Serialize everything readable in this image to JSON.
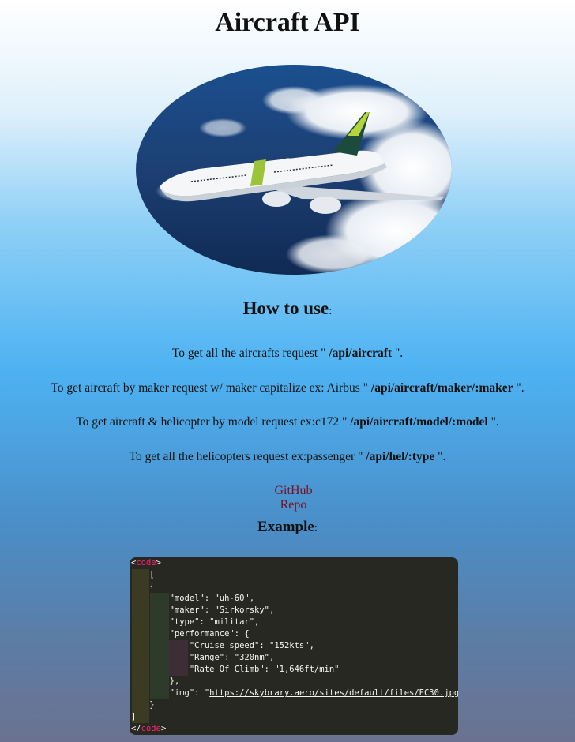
{
  "page": {
    "title": "Aircraft API"
  },
  "how_to_use": {
    "heading": "How to use",
    "colon": ":",
    "instructions": [
      {
        "prefix": "To get all the aircrafts request \" ",
        "route": "/api/aircraft",
        "suffix": " \"."
      },
      {
        "prefix": "To get aircraft by maker request w/ maker capitalize ex: Airbus \" ",
        "route": "/api/aircraft/maker/:maker",
        "suffix": " \"."
      },
      {
        "prefix": "To get aircraft & helicopter by model request ex:c172 \" ",
        "route": "/api/aircraft/model/:model",
        "suffix": " \"."
      },
      {
        "prefix": "To get all the helicopters request ex:passenger \" ",
        "route": "/api/hel/:type",
        "suffix": " \"."
      }
    ]
  },
  "github_link": {
    "label": "GitHub Repo"
  },
  "example": {
    "heading": "Example",
    "colon": ":",
    "code_open_tag": "code",
    "code_close_tag": "code",
    "lines": [
      "    [",
      "    {",
      "        \"model\": \"uh-60\",",
      "        \"maker\": \"Sirkorsky\",",
      "        \"type\": \"militar\",",
      "        \"performance\": {",
      "            \"Cruise speed\": \"152kts\",",
      "            \"Range\": \"320nm\",",
      "            \"Rate Of Climb\": \"1,646ft/min\"",
      "        },",
      "        \"img\": \""
    ],
    "img_url": "https://skybrary.aero/sites/default/files/EC30.jpg",
    "img_suffix": "\"",
    "closing_lines": [
      "    }",
      "]"
    ]
  },
  "colors": {
    "link": "#7a0d1f",
    "code_bg": "#272822",
    "code_tag": "#f92672"
  }
}
